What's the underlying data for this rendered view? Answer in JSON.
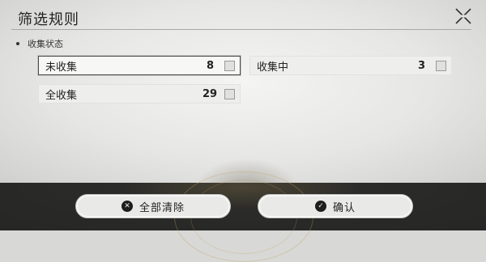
{
  "dialog": {
    "title": "筛选规则",
    "close_icon": "close-x-icon"
  },
  "section": {
    "title": "收集状态"
  },
  "options": [
    {
      "label": "未收集",
      "count": "8",
      "selected": true,
      "checked": false
    },
    {
      "label": "收集中",
      "count": "3",
      "selected": false,
      "checked": false
    },
    {
      "label": "全收集",
      "count": "29",
      "selected": false,
      "checked": false
    }
  ],
  "footer": {
    "clear": {
      "label": "全部清除",
      "icon": "clear-x-icon"
    },
    "confirm": {
      "label": "确认",
      "icon": "checkmark-icon"
    }
  },
  "colors": {
    "footer_bg": "#262625",
    "accent": "#1e1e1e",
    "panel_bg": "#eeeeec"
  }
}
